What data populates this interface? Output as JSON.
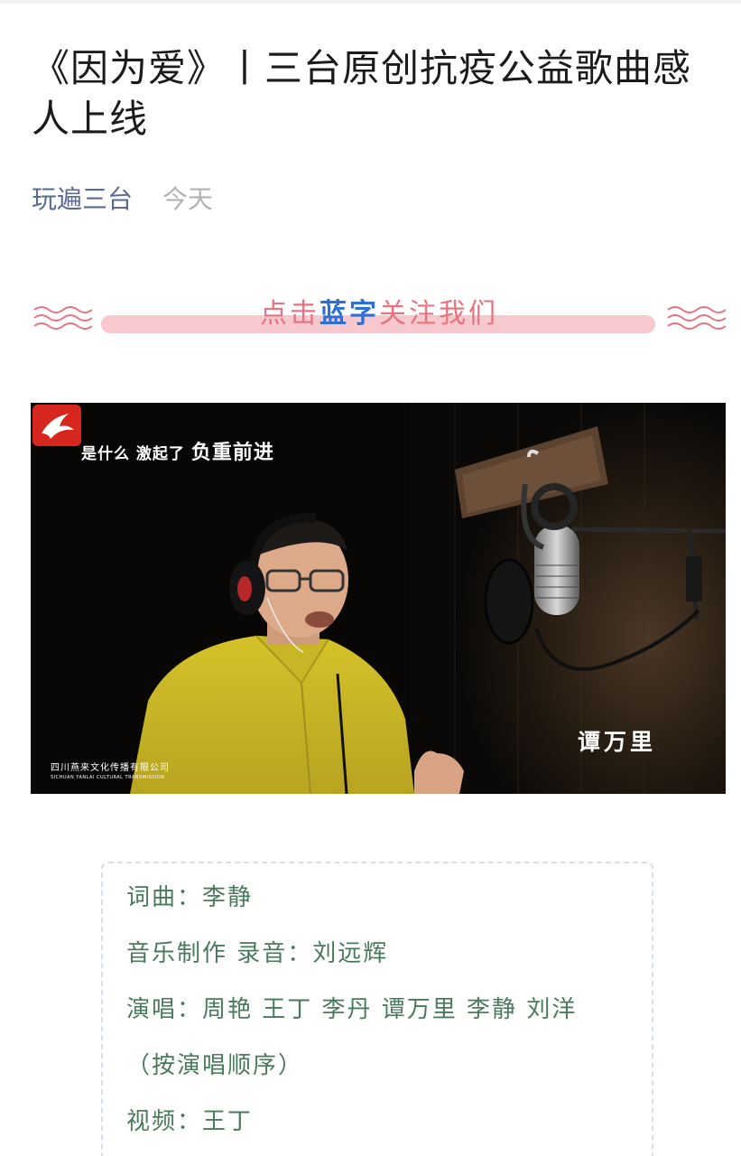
{
  "article": {
    "title": "《因为爱》丨三台原创抗疫公益歌曲感人上线",
    "account": "玩遍三台",
    "date": "今天"
  },
  "follow_banner": {
    "prefix": "点击",
    "highlight": "蓝字",
    "suffix": "关注我们",
    "colors": {
      "text": "#e8737f",
      "highlight": "#2d6fd3",
      "bar": "#f8c8cf"
    }
  },
  "video_frame": {
    "lyric_small": "是什么  激起了",
    "lyric_big": "负重前进",
    "singer_caption": "谭万里",
    "studio_name": "四川燕来文化传播有限公司",
    "studio_name_en": "SICHUAN YANLAI CULTURAL TRANSMISSION"
  },
  "credits": [
    "词曲：李静",
    "音乐制作 录音：刘远辉",
    "演唱：周艳 王丁 李丹 谭万里 李静 刘洋",
    "（按演唱顺序）",
    "视频：王丁"
  ],
  "colors": {
    "title": "#1b1b1b",
    "account_link": "#576b95",
    "date": "#b2b2b2",
    "credits_text": "#4a7a5c"
  }
}
